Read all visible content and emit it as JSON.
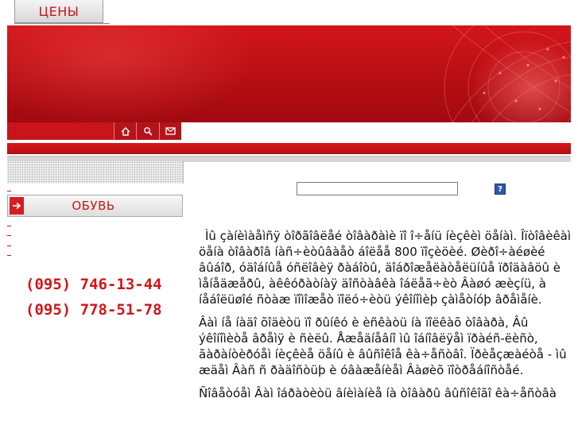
{
  "top_tab": {
    "label": "ЦЕНЫ"
  },
  "sidebar": {
    "category_button": {
      "label": "ОБУВЬ"
    },
    "phones": [
      "(095) 746-13-44",
      "(095) 778-51-78"
    ]
  },
  "nav": {
    "icons": [
      "home-icon",
      "search-icon",
      "mail-icon"
    ]
  },
  "search": {
    "value": "",
    "help_label": "?"
  },
  "content": {
    "paragraphs": [
      "Ìû çàíèìàåìñÿ òîðãîâëåé òîâàðàìè ïî î÷åíü íèçêèì öåíàì. Îïòîâèêàì öåíà òîâàðîâ íàñ÷èòûâàåò áîëåå 800 ïîçèöèé. Øèðî÷àéøèé âûáîð, óäîáíûå óñëîâèÿ ðàáîòû, äîáðîæåëàòåëüíûå ïðîäàâöû è ìåíåäæåðû, àêêóðàòíàÿ äîñòàâêà îáëåã÷èò Âàøó æèçíü, à íåáîëüøîé ñòàæ ïîìîæåò ïîëó÷èòü ýêîíîìèþ çàìåòíóþ âðåìåíè.",
      "Âàì íå íàäî õîäèòü ïî ðûíêó è èñêàòü íà ïîëêàõ òîâàðà, Âû ýêîíîìèòå âðåìÿ è ñèëû. Åæåäíåâíî ìû îáíîâëÿåì ïðàéñ-ëèñò, ãàðàíòèðóåì íèçêèå öåíû è âûñîêîå êà÷åñòâî. Ïðèåçæàéòå - ìû æäåì Âàñ ñ ðàäîñòüþ è óâàæåíèåì Âàøèõ ïîòðåáíîñòåé.",
      "Ñîâåòóåì Âàì îáðàòèòü âíèìàíèå íà òîâàðû âûñîêîãî êà÷åñòâà"
    ]
  },
  "colors": {
    "brand_red": "#c8141a",
    "text": "#111111",
    "help_blue": "#2f57a8"
  }
}
